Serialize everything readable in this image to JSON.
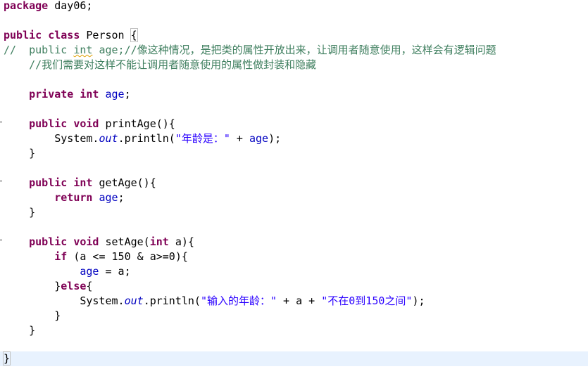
{
  "code": {
    "l1": {
      "kw": "package",
      "rest": " day06;"
    },
    "l3": {
      "kw1": "public",
      "kw2": "class",
      "name": " Person ",
      "brace": "{"
    },
    "l4": {
      "prefix": "//  ",
      "p1": "public",
      "sp": " ",
      "p2": "int",
      "p3": " age;//像这种情况，是把类的属性开放出来，让调用者随意使用，这样会有逻辑问题"
    },
    "l5": {
      "text": "    //我们需要对这样不能让调用者随意使用的属性做封装和隐藏"
    },
    "l7": {
      "kw1": "private",
      "kw2": "int",
      "field": "age",
      "end": ";"
    },
    "l9": {
      "kw1": "public",
      "kw2": "void",
      "rest": " printAge(){"
    },
    "l10": {
      "pre": "System.",
      "sfield": "out",
      "mid": ".println(",
      "str": "\"年龄是：\"",
      "plus": " + ",
      "field": "age",
      "end": ");"
    },
    "l11": {
      "text": "}"
    },
    "l13": {
      "kw1": "public",
      "kw2": "int",
      "rest": " getAge(){"
    },
    "l14": {
      "kw": "return",
      "field": "age",
      "end": ";"
    },
    "l15": {
      "text": "}"
    },
    "l17": {
      "kw1": "public",
      "kw2": "void",
      "name": " setAge(",
      "kw3": "int",
      "rest": " a){"
    },
    "l18": {
      "kw": "if",
      "rest": " (a <= 150 & a>=0){"
    },
    "l19": {
      "field": "age",
      "rest": " = a;"
    },
    "l20": {
      "pre": "}",
      "kw": "else",
      "rest": "{"
    },
    "l21": {
      "pre": "System.",
      "sfield": "out",
      "mid": ".println(",
      "str1": "\"输入的年龄：\"",
      "plus": " + a + ",
      "str2": "\"不在0到150之间\"",
      "end": ");"
    },
    "l22": {
      "text": "}"
    },
    "l23": {
      "text": "}"
    },
    "l25": {
      "text": "}"
    }
  }
}
